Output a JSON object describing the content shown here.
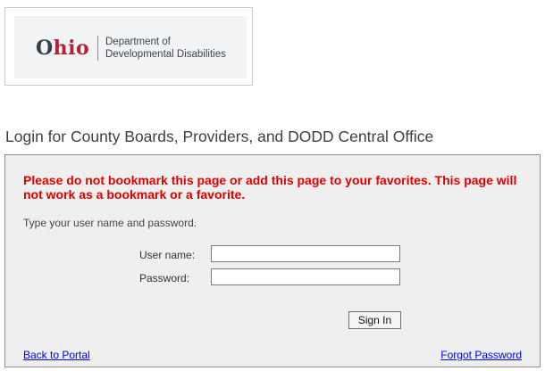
{
  "logo": {
    "ohio_first": "O",
    "ohio_rest": "hio",
    "dept_line1": "Department of",
    "dept_line2": "Developmental Disabilities"
  },
  "page": {
    "heading": "Login for County Boards, Providers, and DODD Central Office"
  },
  "login": {
    "warning": "Please do not bookmark this page or add this page to your favorites. This page will not work as a bookmark or a favorite.",
    "instruction": "Type your user name and password.",
    "username_label": "User name:",
    "username_value": "",
    "password_label": "Password:",
    "password_value": "",
    "signin_label": "Sign In",
    "back_link": "Back to Portal",
    "forgot_link": "Forgot Password"
  },
  "colors": {
    "warning": "#e00000",
    "link": "#0000ee",
    "ohio_red": "#b22234",
    "panel_bg": "#efefef"
  }
}
